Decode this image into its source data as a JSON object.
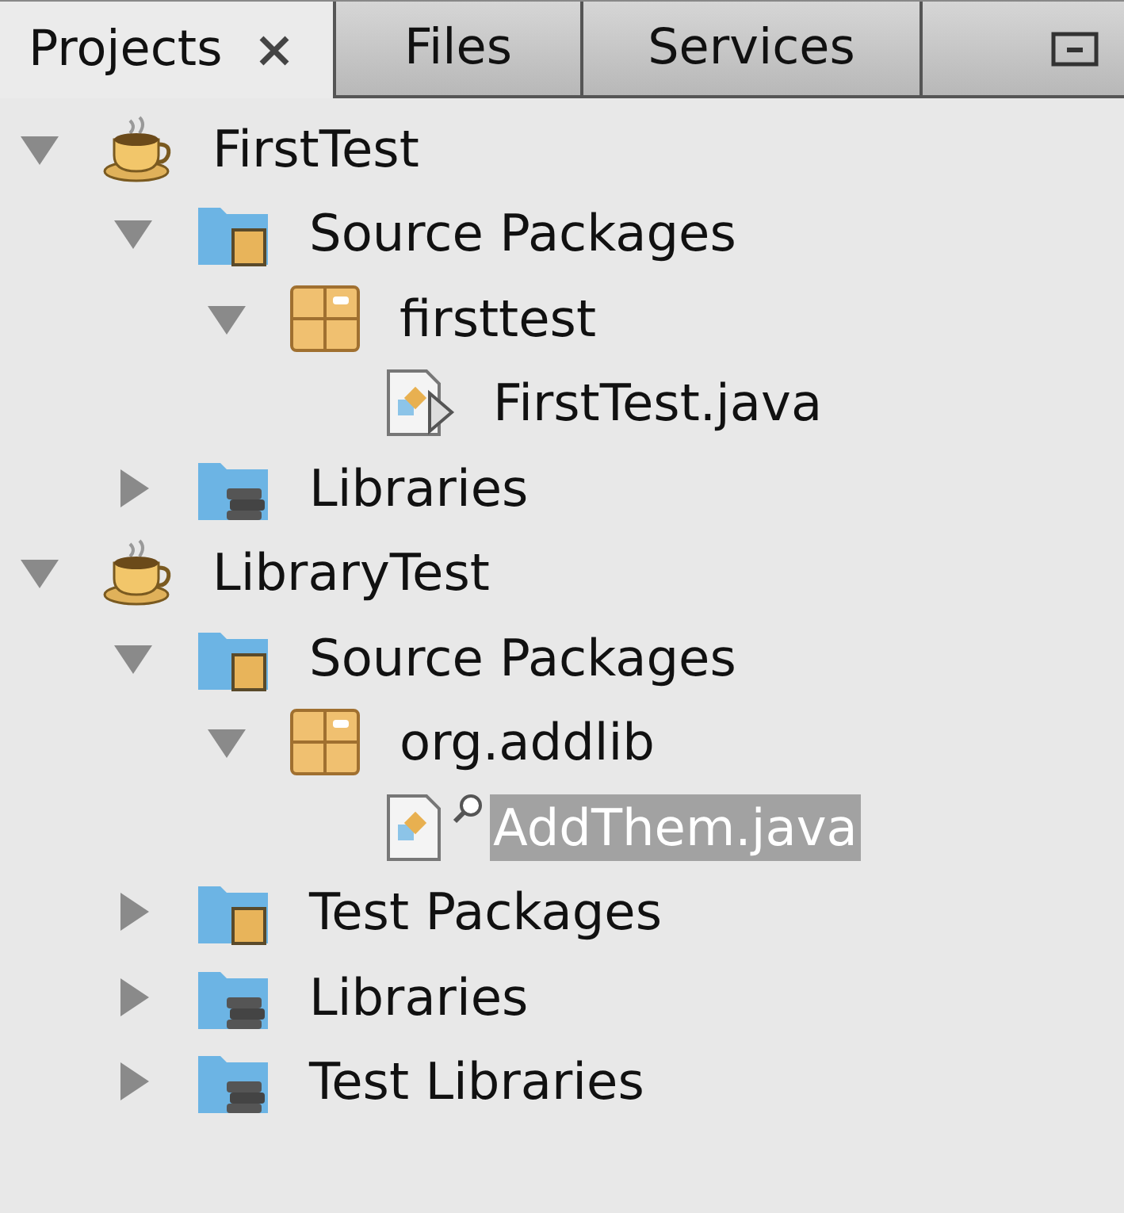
{
  "tabs": [
    {
      "label": "Projects",
      "selected": true,
      "closable": true
    },
    {
      "label": "Files",
      "selected": false,
      "closable": false
    },
    {
      "label": "Services",
      "selected": false,
      "closable": false
    }
  ],
  "tree": [
    {
      "kind": "project",
      "label": "FirstTest",
      "expanded": true,
      "selected": false,
      "children": [
        {
          "kind": "source",
          "label": "Source Packages",
          "expanded": true,
          "selected": false,
          "children": [
            {
              "kind": "package",
              "label": "firsttest",
              "expanded": true,
              "selected": false,
              "children": [
                {
                  "kind": "java",
                  "label": "FirstTest.java",
                  "selected": false,
                  "runnable": true,
                  "badged": false
                }
              ]
            }
          ]
        },
        {
          "kind": "library",
          "label": "Libraries",
          "expanded": false,
          "selected": false
        }
      ]
    },
    {
      "kind": "project",
      "label": "LibraryTest",
      "expanded": true,
      "selected": false,
      "children": [
        {
          "kind": "source",
          "label": "Source Packages",
          "expanded": true,
          "selected": false,
          "children": [
            {
              "kind": "package",
              "label": "org.addlib",
              "expanded": true,
              "selected": false,
              "children": [
                {
                  "kind": "java",
                  "label": "AddThem.java",
                  "selected": true,
                  "runnable": false,
                  "badged": true
                }
              ]
            }
          ]
        },
        {
          "kind": "source",
          "label": "Test Packages",
          "expanded": false,
          "selected": false
        },
        {
          "kind": "library",
          "label": "Libraries",
          "expanded": false,
          "selected": false
        },
        {
          "kind": "library",
          "label": "Test Libraries",
          "expanded": false,
          "selected": false
        }
      ]
    }
  ]
}
